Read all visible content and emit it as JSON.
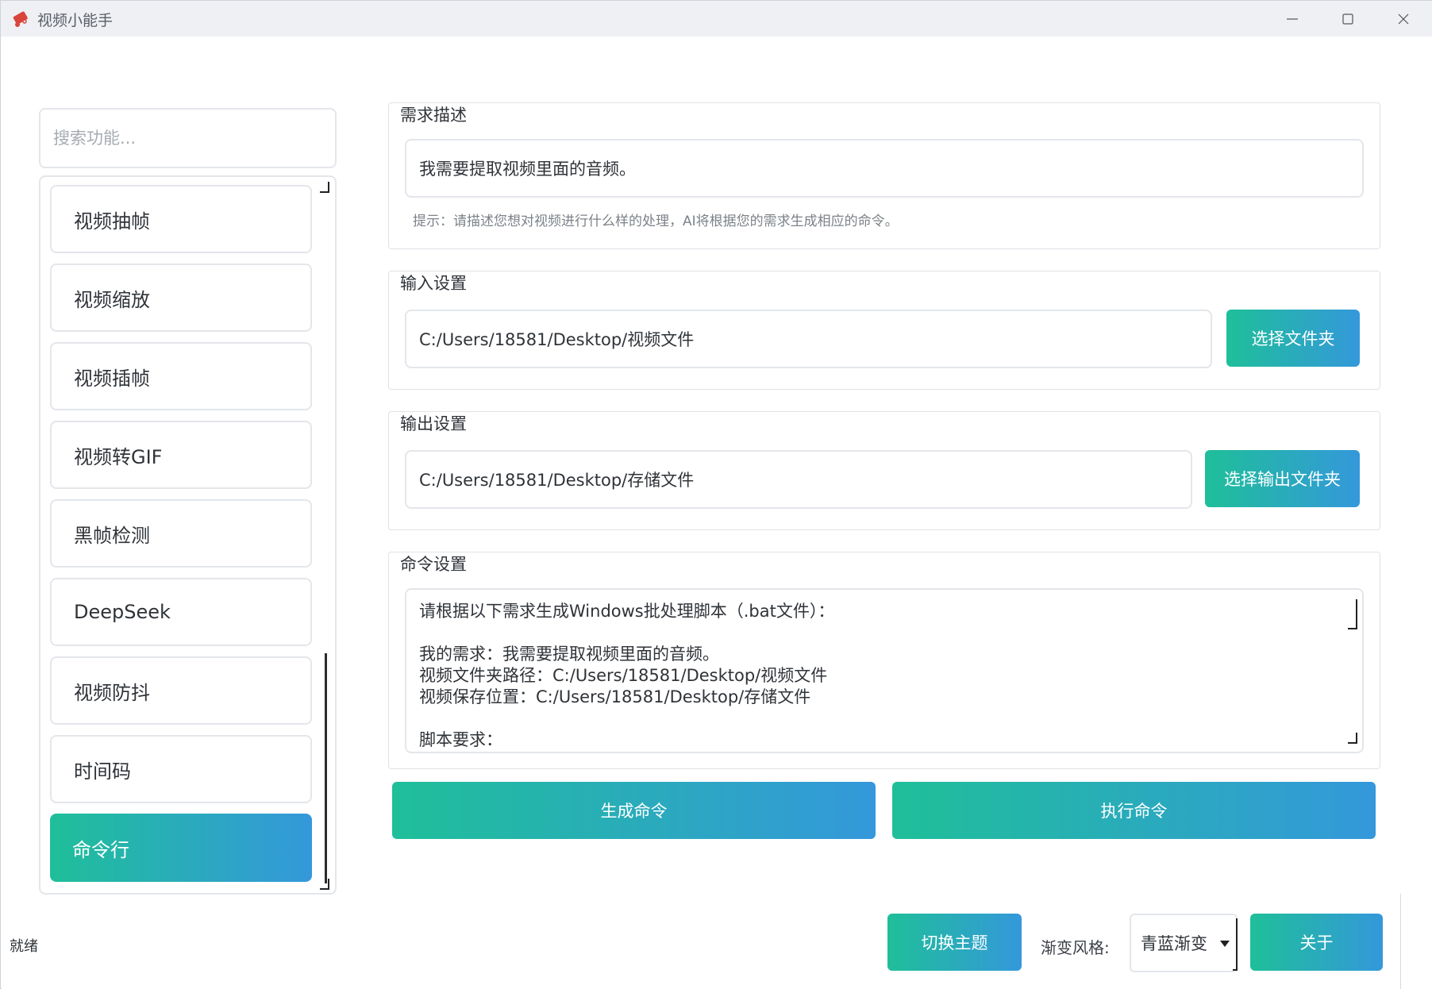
{
  "window": {
    "title": "视频小能手",
    "controls": [
      "minimize-icon",
      "maximize-icon",
      "close-icon"
    ]
  },
  "sidebar": {
    "search_placeholder": "搜索功能...",
    "items": [
      {
        "label": "视频抽帧",
        "active": false
      },
      {
        "label": "视频缩放",
        "active": false
      },
      {
        "label": "视频插帧",
        "active": false
      },
      {
        "label": "视频转GIF",
        "active": false
      },
      {
        "label": "黑帧检测",
        "active": false
      },
      {
        "label": "DeepSeek",
        "active": false
      },
      {
        "label": "视频防抖",
        "active": false
      },
      {
        "label": "时间码",
        "active": false
      },
      {
        "label": "命令行",
        "active": true
      }
    ]
  },
  "requirement": {
    "title": "需求描述",
    "value": "我需要提取视频里面的音频。",
    "hint": "提示：请描述您想对视频进行什么样的处理，AI将根据您的需求生成相应的命令。"
  },
  "input_settings": {
    "title": "输入设置",
    "path": "C:/Users/18581/Desktop/视频文件",
    "button": "选择文件夹"
  },
  "output_settings": {
    "title": "输出设置",
    "path": "C:/Users/18581/Desktop/存储文件",
    "button": "选择输出文件夹"
  },
  "command_settings": {
    "title": "命令设置",
    "lines": [
      "请根据以下需求生成Windows批处理脚本（.bat文件）：",
      "",
      "我的需求：我需要提取视频里面的音频。",
      "视频文件夹路径：C:/Users/18581/Desktop/视频文件",
      "视频保存位置：C:/Users/18581/Desktop/存储文件",
      "",
      "脚本要求："
    ]
  },
  "actions": {
    "generate": "生成命令",
    "execute": "执行命令"
  },
  "footer": {
    "status": "就绪",
    "theme_button": "切换主题",
    "style_label": "渐变风格:",
    "style_value": "青蓝渐变",
    "about_button": "关于"
  },
  "colors": {
    "gradient_start": "#1fbf99",
    "gradient_end": "#3498db"
  }
}
